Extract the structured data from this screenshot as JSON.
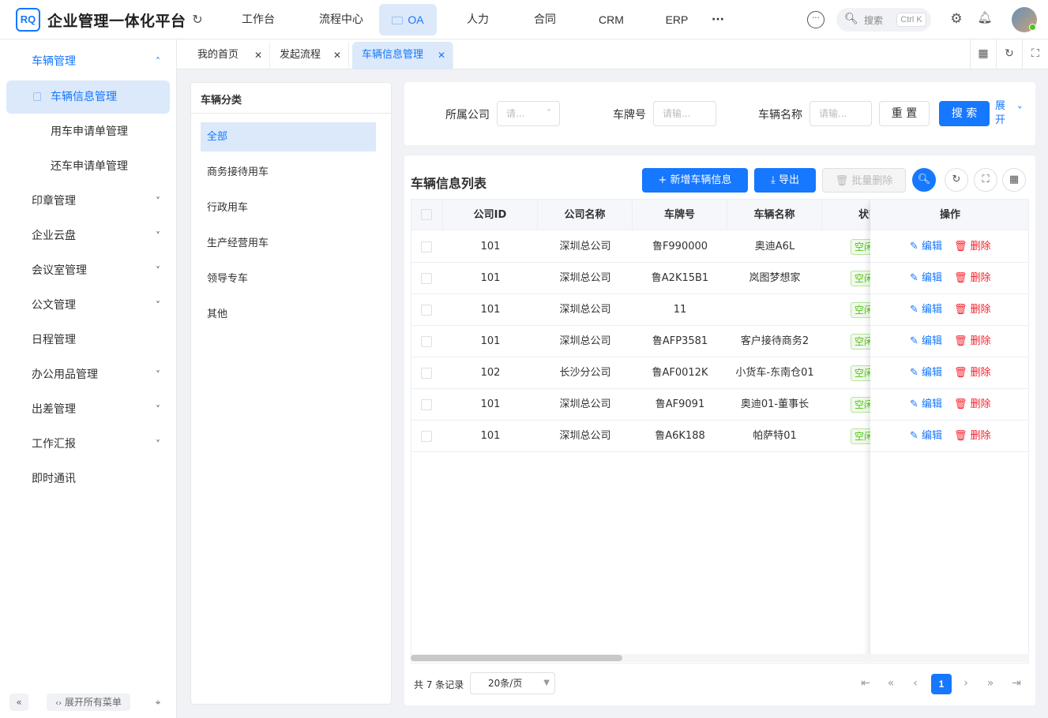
{
  "header": {
    "logo": "RQ",
    "title": "企业管理一体化平台",
    "nav": [
      "工作台",
      "流程中心",
      "OA",
      "人力",
      "合同",
      "CRM",
      "ERP"
    ],
    "more": "···",
    "search_placeholder": "搜索",
    "search_shortcut": "Ctrl K"
  },
  "sidebar": {
    "parent": "车辆管理",
    "sub": [
      "车辆信息管理",
      "用车申请单管理",
      "还车申请单管理"
    ],
    "menus": [
      "印章管理",
      "企业云盘",
      "会议室管理",
      "公文管理",
      "日程管理",
      "办公用品管理",
      "出差管理",
      "工作汇报",
      "即时通讯"
    ],
    "expand_all": "展开所有菜单"
  },
  "tabs": [
    "我的首页",
    "发起流程",
    "车辆信息管理"
  ],
  "category": {
    "title": "车辆分类",
    "items": [
      "全部",
      "商务接待用车",
      "行政用车",
      "生产经营用车",
      "领导专车",
      "其他"
    ]
  },
  "filter": {
    "company_label": "所属公司",
    "company_placeholder": "请...",
    "plate_label": "车牌号",
    "plate_placeholder": "请输...",
    "name_label": "车辆名称",
    "name_placeholder": "请输...",
    "reset": "重 置",
    "search": "搜 索",
    "expand": "展开"
  },
  "list": {
    "title": "车辆信息列表",
    "add": "新增车辆信息",
    "export": "导出",
    "batch_delete": "批量删除"
  },
  "table": {
    "columns": [
      "公司ID",
      "公司名称",
      "车牌号",
      "车辆名称",
      "状态",
      "操作"
    ],
    "status_text": "空闲",
    "edit": "编辑",
    "delete": "删除",
    "rows": [
      {
        "id": "101",
        "company": "深圳总公司",
        "plate": "鲁F990000",
        "name": "奥迪A6L"
      },
      {
        "id": "101",
        "company": "深圳总公司",
        "plate": "鲁A2K15B1",
        "name": "岚图梦想家"
      },
      {
        "id": "101",
        "company": "深圳总公司",
        "plate": "11",
        "name": ""
      },
      {
        "id": "101",
        "company": "深圳总公司",
        "plate": "鲁AFP3581",
        "name": "客户接待商务2"
      },
      {
        "id": "102",
        "company": "长沙分公司",
        "plate": "鲁AF0012K",
        "name": "小货车-东南仓01"
      },
      {
        "id": "101",
        "company": "深圳总公司",
        "plate": "鲁AF9091",
        "name": "奥迪01-董事长"
      },
      {
        "id": "101",
        "company": "深圳总公司",
        "plate": "鲁A6K188",
        "name": "帕萨特01"
      }
    ]
  },
  "pagination": {
    "total": "共 7 条记录",
    "page_size": "20条/页",
    "current": "1"
  },
  "colors": {
    "primary": "#1677ff",
    "selected_bg": "#dbe9fb",
    "danger": "#f5222d",
    "success": "#52c41a"
  }
}
